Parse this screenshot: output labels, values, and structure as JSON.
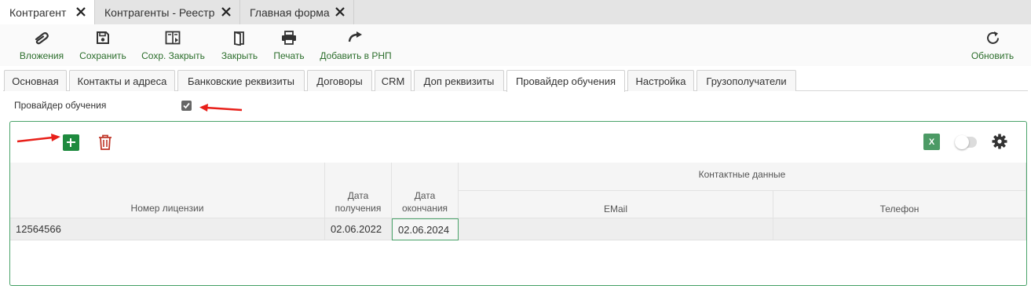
{
  "doc_tabs": [
    {
      "label": "Контрагент"
    },
    {
      "label": "Контрагенты - Реестр"
    },
    {
      "label": "Главная форма"
    }
  ],
  "toolbar": {
    "attachments": "Вложения",
    "save": "Сохранить",
    "save_close": "Сохр. Закрыть",
    "close": "Закрыть",
    "print": "Печать",
    "add_rnp": "Добавить в РНП",
    "refresh": "Обновить"
  },
  "form_tabs": [
    {
      "label": "Основная"
    },
    {
      "label": "Контакты и адреса"
    },
    {
      "label": "Банковские реквизиты"
    },
    {
      "label": "Договоры"
    },
    {
      "label": "CRM"
    },
    {
      "label": "Доп реквизиты"
    },
    {
      "label": "Провайдер обучения"
    },
    {
      "label": "Настройка"
    },
    {
      "label": "Грузополучатели"
    }
  ],
  "active_form_tab": "Провайдер обучения",
  "training_provider": {
    "label": "Провайдер обучения",
    "checked": true
  },
  "grid": {
    "excel_label": "X",
    "headers": {
      "license": "Номер лицензии",
      "received_1": "Дата",
      "received_2": "получения",
      "expiry_1": "Дата",
      "expiry_2": "окончания",
      "contacts": "Контактные данные",
      "email": "EMail",
      "phone": "Телефон"
    },
    "rows": [
      {
        "license": "12564566",
        "received": "02.06.2022",
        "expiry": "02.06.2024",
        "email": "",
        "phone": ""
      }
    ]
  },
  "colors": {
    "accent_green": "#1e8a3e",
    "label_green": "#2c6e2c",
    "delete_red": "#c0392b",
    "annotation_red": "#e8201a"
  }
}
